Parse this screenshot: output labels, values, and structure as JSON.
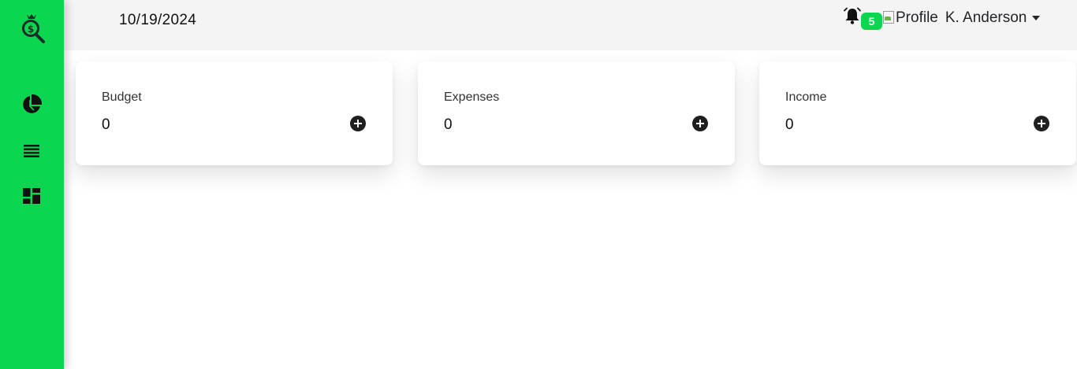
{
  "header": {
    "date": "10/19/2024",
    "notification_count": "5",
    "profile_image_alt": "Profile",
    "user_name": "K. Anderson"
  },
  "sidebar": {
    "logo_icon": "money-bag-search-icon",
    "items": [
      {
        "icon": "pie-chart-icon"
      },
      {
        "icon": "list-icon"
      },
      {
        "icon": "dashboard-icon"
      }
    ]
  },
  "cards": [
    {
      "label": "Budget",
      "value": "0",
      "action_icon": "plus-circle-icon"
    },
    {
      "label": "Expenses",
      "value": "0",
      "action_icon": "plus-circle-icon"
    },
    {
      "label": "Income",
      "value": "0",
      "action_icon": "plus-circle-icon"
    }
  ],
  "colors": {
    "accent": "#0ad650",
    "topbar_bg": "#f4f4f4",
    "page_bg": "#ffffff",
    "icon_dark": "#1f1f1f"
  }
}
